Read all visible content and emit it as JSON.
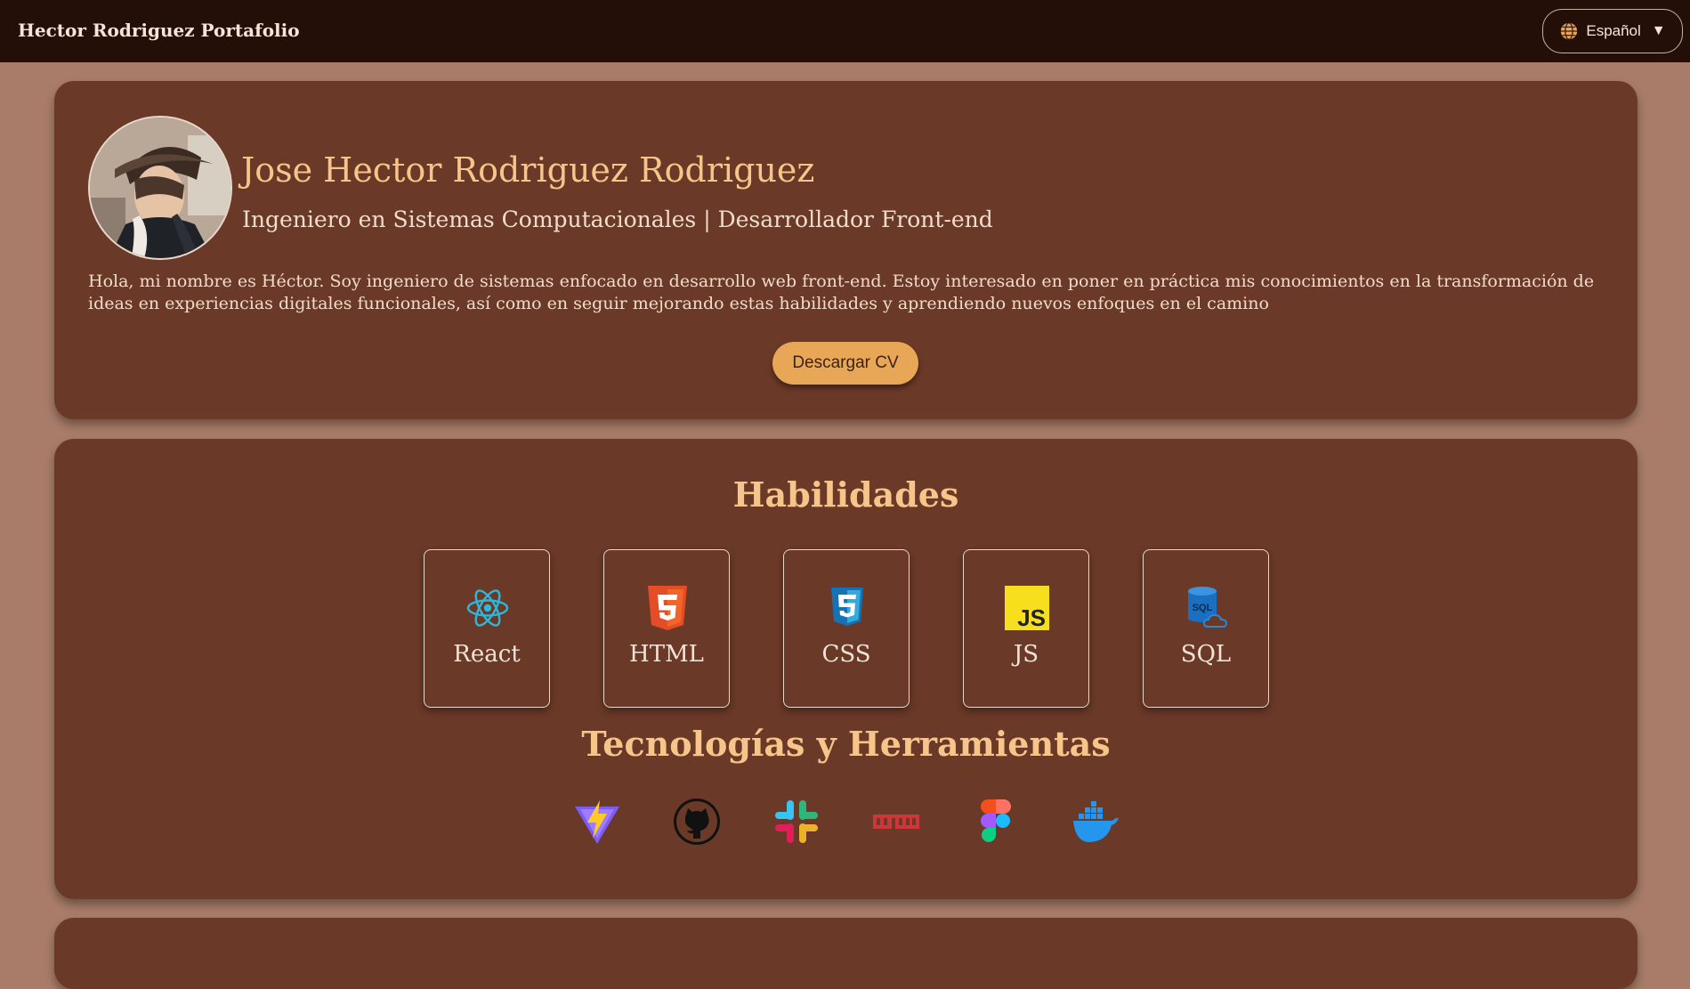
{
  "header": {
    "brand": "Hector Rodriguez Portafolio",
    "language_label": "Español",
    "language_icon": "globe-icon",
    "dropdown_icon": "triangle-down-icon"
  },
  "profile": {
    "name": "Jose Hector Rodriguez Rodriguez",
    "subtitle": "Ingeniero en Sistemas Computacionales | Desarrollador Front-end",
    "bio": "Hola, mi nombre es Héctor. Soy ingeniero de sistemas enfocado en desarrollo web front-end. Estoy interesado en poner en práctica mis conocimientos en la transformación de ideas en experiencias digitales funcionales, así como en seguir mejorando estas habilidades y aprendiendo nuevos enfoques en el camino",
    "cv_button": "Descargar CV"
  },
  "skills": {
    "title": "Habilidades",
    "items": [
      {
        "label": "React",
        "icon": "react-icon"
      },
      {
        "label": "HTML",
        "icon": "html5-icon"
      },
      {
        "label": "CSS",
        "icon": "css3-icon"
      },
      {
        "label": "JS",
        "icon": "javascript-icon"
      },
      {
        "label": "SQL",
        "icon": "sql-database-icon"
      }
    ]
  },
  "tools": {
    "title": "Tecnologías y Herramientas",
    "items": [
      "vite-icon",
      "github-icon",
      "slack-icon",
      "npm-icon",
      "figma-icon",
      "docker-icon"
    ]
  },
  "colors": {
    "page_background": "#a87c68",
    "navbar": "#240f08",
    "card": "#6a3927",
    "heading": "#f7c58a",
    "button": "#e8a756"
  }
}
